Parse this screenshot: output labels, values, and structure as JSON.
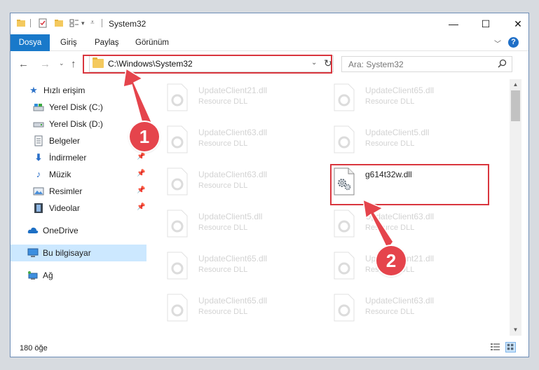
{
  "window": {
    "title": "System32"
  },
  "ribbon": {
    "tabs": [
      "Dosya",
      "Giriş",
      "Paylaş",
      "Görünüm"
    ]
  },
  "nav": {
    "back_icon": "arrow-left-icon",
    "forward_icon": "arrow-right-icon",
    "recent_icon": "chevron-down-icon",
    "up_icon": "arrow-up-icon"
  },
  "address": {
    "path": "C:\\Windows\\System32"
  },
  "search": {
    "placeholder": "Ara: System32"
  },
  "sidebar": {
    "items": [
      {
        "label": "Hızlı erişim",
        "icon": "star-icon"
      },
      {
        "label": "Yerel Disk (C:)",
        "icon": "drive-icon"
      },
      {
        "label": "Yerel Disk (D:)",
        "icon": "drive-icon"
      },
      {
        "label": "Belgeler",
        "icon": "documents-icon"
      },
      {
        "label": "İndirmeler",
        "icon": "download-icon"
      },
      {
        "label": "Müzik",
        "icon": "music-icon"
      },
      {
        "label": "Resimler",
        "icon": "pictures-icon"
      },
      {
        "label": "Videolar",
        "icon": "video-icon"
      },
      {
        "label": "OneDrive",
        "icon": "cloud-icon"
      },
      {
        "label": "Bu bilgisayar",
        "icon": "computer-icon"
      },
      {
        "label": "Ağ",
        "icon": "network-icon"
      }
    ]
  },
  "files": [
    {
      "name": "UpdateClient21.dll",
      "type": "Resource DLL"
    },
    {
      "name": "UpdateClient65.dll",
      "type": "Resource DLL"
    },
    {
      "name": "UpdateClient63.dll",
      "type": "Resource DLL"
    },
    {
      "name": "UpdateClient5.dll",
      "type": "Resource DLL"
    },
    {
      "name": "UpdateClient63.dll",
      "type": "Resource DLL"
    },
    {
      "name": "g614t32w.dll",
      "type": ""
    },
    {
      "name": "UpdateClient5.dll",
      "type": "Resource DLL"
    },
    {
      "name": "UpdateClient63.dll",
      "type": "Resource DLL"
    },
    {
      "name": "UpdateClient65.dll",
      "type": "Resource DLL"
    },
    {
      "name": "UpdateClient21.dll",
      "type": "Resource DLL"
    },
    {
      "name": "UpdateClient65.dll",
      "type": "Resource DLL"
    },
    {
      "name": "UpdateClient63.dll",
      "type": "Resource DLL"
    }
  ],
  "status": {
    "count": "180 öğe"
  },
  "annotations": {
    "step1": "1",
    "step2": "2",
    "color": "#e5444c"
  }
}
